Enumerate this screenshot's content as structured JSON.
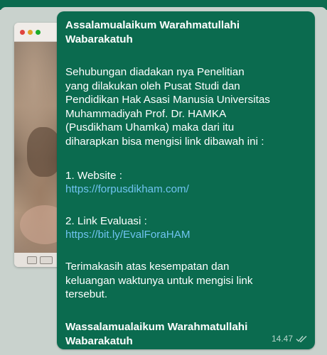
{
  "message": {
    "greeting": "Assalamualaikum Warahmatullahi\nWabarakatuh",
    "body": "Sehubungan diadakan nya Penelitian\nyang dilakukan oleh Pusat Studi dan\nPendidikan Hak Asasi Manusia Universitas\nMuhammadiyah Prof. Dr. HAMKA\n(Pusdikham Uhamka) maka dari itu\ndiharapkan bisa mengisi link dibawah ini :",
    "link1_label": "1. Website :",
    "link1_url": "https://forpusdikham.com/",
    "link2_label": "2. Link Evaluasi :",
    "link2_url": "https://bit.ly/EvalForaHAM",
    "thanks": "Terimakasih atas kesempatan dan\nkeluangan waktunya untuk mengisi link\ntersebut.",
    "closing": "Wassalamualaikum Warahmatullahi\nWabarakatuh",
    "time": "14.47",
    "status_icon": "double-check-icon"
  },
  "colors": {
    "bubble": "#0b6b4f",
    "link": "#6fc3f0",
    "text": "#ffffff",
    "meta": "#b8d6cb",
    "background": "#c9d2cd"
  }
}
